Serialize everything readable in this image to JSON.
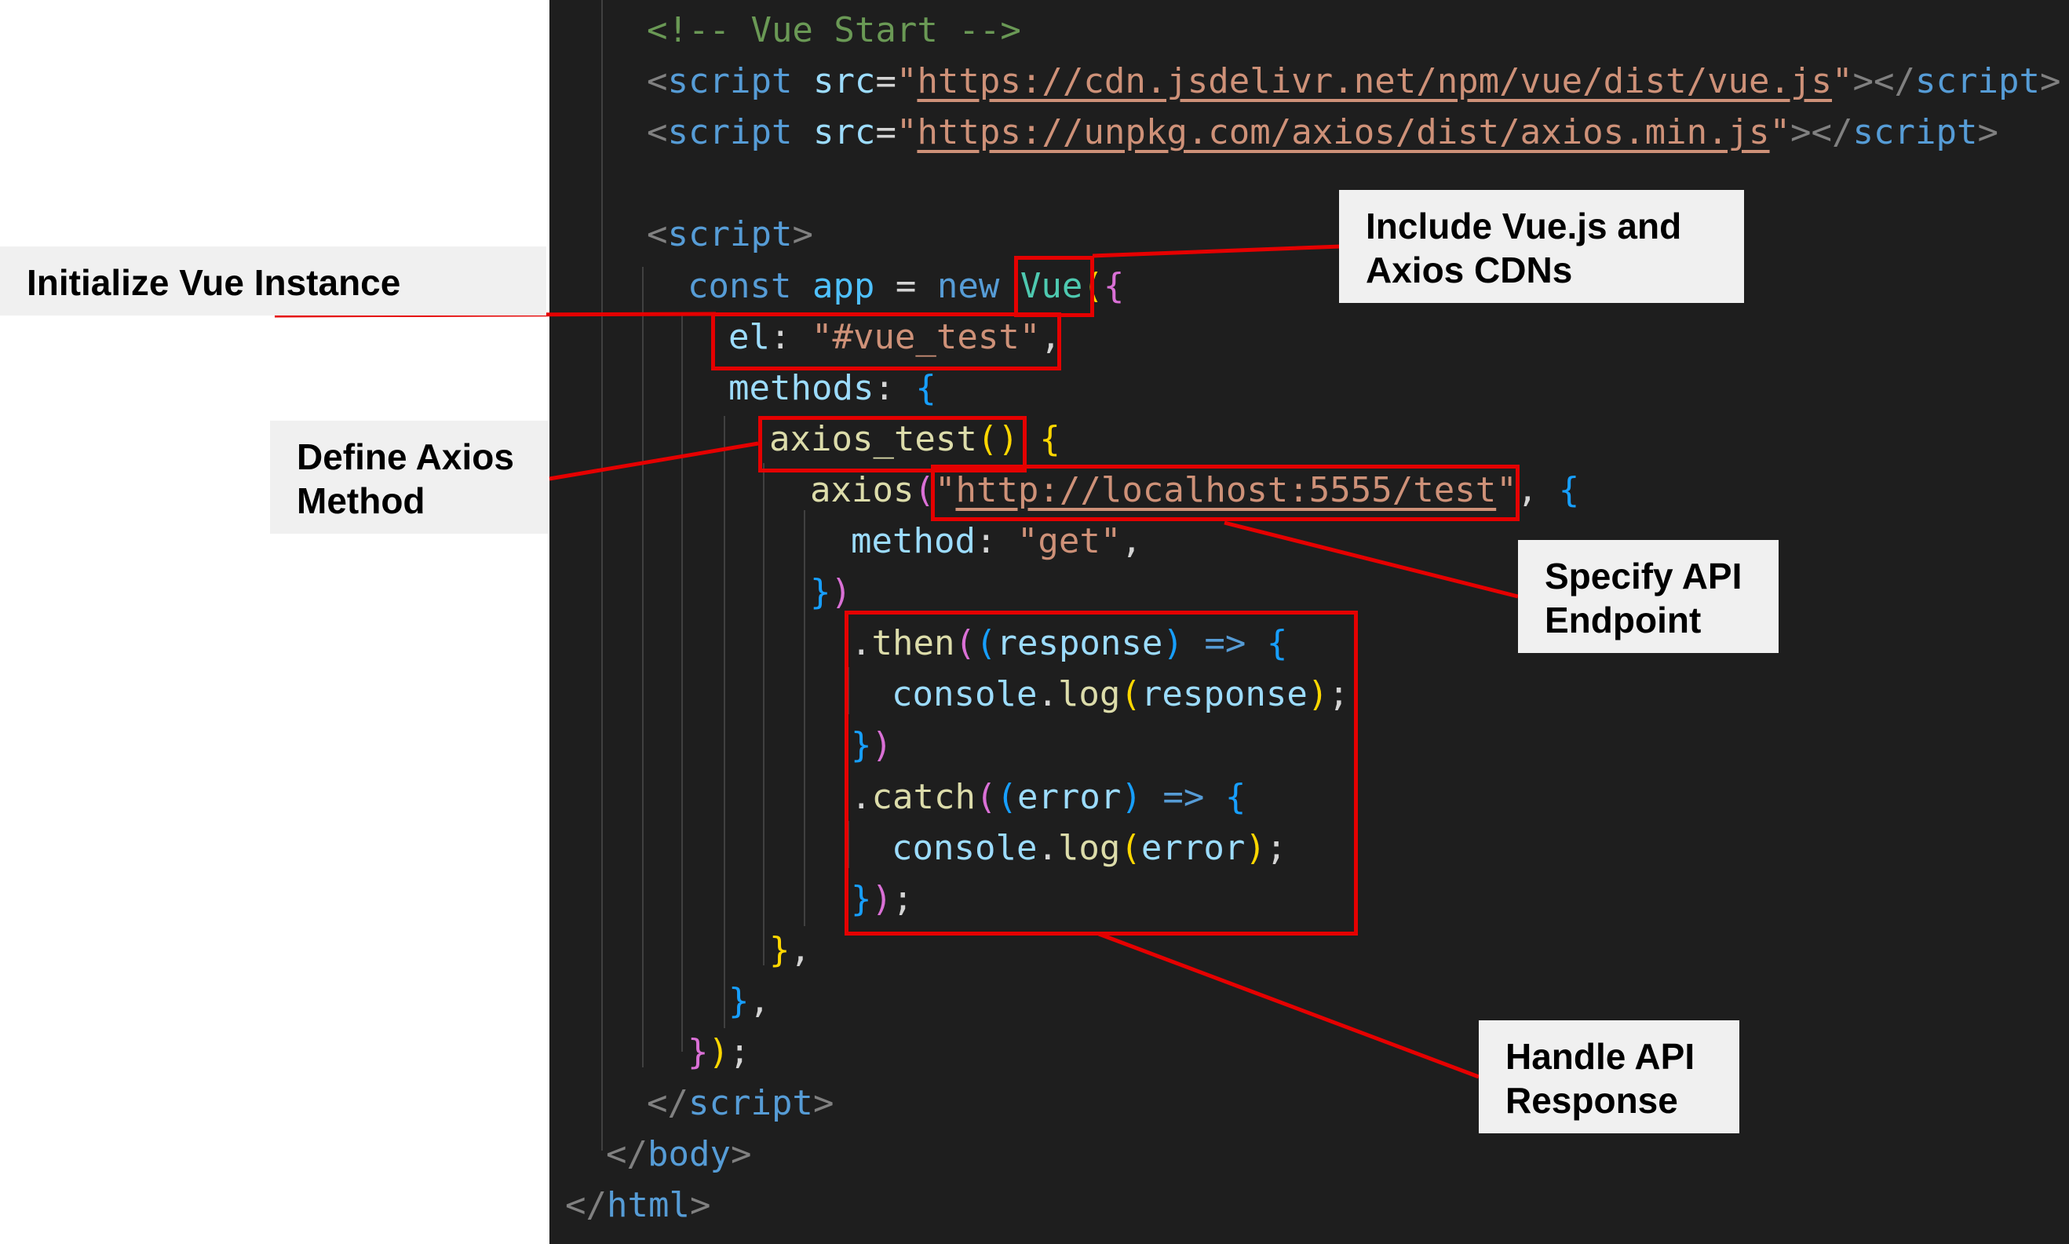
{
  "colors": {
    "editor_bg": "#1e1e1e",
    "comment": "#6a9955",
    "tag": "#569cd6",
    "bracket_angle": "#808080",
    "attribute": "#9cdcfe",
    "string": "#ce9178",
    "keyword": "#569cd6",
    "variable": "#4fc1ff",
    "function": "#dcdcaa",
    "class": "#4ec9b0",
    "bracket_gold": "#ffd700",
    "bracket_pink": "#da70d6",
    "bracket_blue": "#179fff",
    "highlight_red": "#e50000"
  },
  "code": {
    "lines": [
      {
        "tokens": [
          {
            "t": "<!-- Vue Start -->",
            "c": "comment"
          }
        ]
      },
      {
        "tokens": [
          {
            "t": "<",
            "c": "bracket_angle"
          },
          {
            "t": "script",
            "c": "tag"
          },
          {
            "t": " "
          },
          {
            "t": "src",
            "c": "attribute"
          },
          {
            "t": "="
          },
          {
            "t": "\"",
            "c": "string"
          },
          {
            "t": "https://cdn.jsdelivr.net/npm/vue/dist/vue.js",
            "c": "string",
            "u": true
          },
          {
            "t": "\"",
            "c": "string"
          },
          {
            "t": "></",
            "c": "bracket_angle"
          },
          {
            "t": "script",
            "c": "tag"
          },
          {
            "t": ">",
            "c": "bracket_angle"
          }
        ]
      },
      {
        "tokens": [
          {
            "t": "<",
            "c": "bracket_angle"
          },
          {
            "t": "script",
            "c": "tag"
          },
          {
            "t": " "
          },
          {
            "t": "src",
            "c": "attribute"
          },
          {
            "t": "="
          },
          {
            "t": "\"",
            "c": "string"
          },
          {
            "t": "https://unpkg.com/axios/dist/axios.min.js",
            "c": "string",
            "u": true
          },
          {
            "t": "\"",
            "c": "string"
          },
          {
            "t": "></",
            "c": "bracket_angle"
          },
          {
            "t": "script",
            "c": "tag"
          },
          {
            "t": ">",
            "c": "bracket_angle"
          }
        ]
      },
      {
        "tokens": []
      },
      {
        "tokens": [
          {
            "t": "<",
            "c": "bracket_angle"
          },
          {
            "t": "script",
            "c": "tag"
          },
          {
            "t": ">",
            "c": "bracket_angle"
          }
        ]
      },
      {
        "tokens": [
          {
            "t": "const",
            "c": "keyword"
          },
          {
            "t": " "
          },
          {
            "t": "app",
            "c": "variable"
          },
          {
            "t": " = "
          },
          {
            "t": "new",
            "c": "keyword"
          },
          {
            "t": " "
          },
          {
            "t": "Vue",
            "c": "class"
          },
          {
            "t": "(",
            "c": "bracket_gold"
          },
          {
            "t": "{",
            "c": "bracket_pink"
          }
        ]
      },
      {
        "tokens": [
          {
            "t": "el",
            "c": "attribute"
          },
          {
            "t": ": "
          },
          {
            "t": "\"#vue_test\"",
            "c": "string"
          },
          {
            "t": ","
          }
        ]
      },
      {
        "tokens": [
          {
            "t": "methods",
            "c": "attribute"
          },
          {
            "t": ": "
          },
          {
            "t": "{",
            "c": "bracket_blue"
          }
        ]
      },
      {
        "tokens": [
          {
            "t": "axios_test",
            "c": "function"
          },
          {
            "t": "()",
            "c": "bracket_gold"
          },
          {
            "t": " "
          },
          {
            "t": "{",
            "c": "bracket_gold"
          }
        ]
      },
      {
        "tokens": [
          {
            "t": "axios",
            "c": "function"
          },
          {
            "t": "(",
            "c": "bracket_pink"
          },
          {
            "t": "\"",
            "c": "string"
          },
          {
            "t": "http://localhost:5555/test",
            "c": "string",
            "u": true
          },
          {
            "t": "\"",
            "c": "string"
          },
          {
            "t": ", "
          },
          {
            "t": "{",
            "c": "bracket_blue"
          }
        ]
      },
      {
        "tokens": [
          {
            "t": "method",
            "c": "attribute"
          },
          {
            "t": ": "
          },
          {
            "t": "\"get\"",
            "c": "string"
          },
          {
            "t": ","
          }
        ]
      },
      {
        "tokens": [
          {
            "t": "}",
            "c": "bracket_blue"
          },
          {
            "t": ")",
            "c": "bracket_pink"
          }
        ]
      },
      {
        "tokens": [
          {
            "t": "."
          },
          {
            "t": "then",
            "c": "function"
          },
          {
            "t": "(",
            "c": "bracket_pink"
          },
          {
            "t": "(",
            "c": "bracket_blue"
          },
          {
            "t": "response",
            "c": "attribute"
          },
          {
            "t": ")",
            "c": "bracket_blue"
          },
          {
            "t": " "
          },
          {
            "t": "=>",
            "c": "keyword"
          },
          {
            "t": " "
          },
          {
            "t": "{",
            "c": "bracket_blue"
          }
        ]
      },
      {
        "tokens": [
          {
            "t": "console",
            "c": "attribute"
          },
          {
            "t": "."
          },
          {
            "t": "log",
            "c": "function"
          },
          {
            "t": "(",
            "c": "bracket_gold"
          },
          {
            "t": "response",
            "c": "attribute"
          },
          {
            "t": ")",
            "c": "bracket_gold"
          },
          {
            "t": ";"
          }
        ]
      },
      {
        "tokens": [
          {
            "t": "}",
            "c": "bracket_blue"
          },
          {
            "t": ")",
            "c": "bracket_pink"
          }
        ]
      },
      {
        "tokens": [
          {
            "t": "."
          },
          {
            "t": "catch",
            "c": "function"
          },
          {
            "t": "(",
            "c": "bracket_pink"
          },
          {
            "t": "(",
            "c": "bracket_blue"
          },
          {
            "t": "error",
            "c": "attribute"
          },
          {
            "t": ")",
            "c": "bracket_blue"
          },
          {
            "t": " "
          },
          {
            "t": "=>",
            "c": "keyword"
          },
          {
            "t": " "
          },
          {
            "t": "{",
            "c": "bracket_blue"
          }
        ]
      },
      {
        "tokens": [
          {
            "t": "console",
            "c": "attribute"
          },
          {
            "t": "."
          },
          {
            "t": "log",
            "c": "function"
          },
          {
            "t": "(",
            "c": "bracket_gold"
          },
          {
            "t": "error",
            "c": "attribute"
          },
          {
            "t": ")",
            "c": "bracket_gold"
          },
          {
            "t": ";"
          }
        ]
      },
      {
        "tokens": [
          {
            "t": "}",
            "c": "bracket_blue"
          },
          {
            "t": ")",
            "c": "bracket_pink"
          },
          {
            "t": ";"
          }
        ]
      },
      {
        "tokens": [
          {
            "t": "}",
            "c": "bracket_gold"
          },
          {
            "t": ","
          }
        ]
      },
      {
        "tokens": [
          {
            "t": "}",
            "c": "bracket_blue"
          },
          {
            "t": ","
          }
        ]
      },
      {
        "tokens": [
          {
            "t": "}",
            "c": "bracket_pink"
          },
          {
            "t": ")",
            "c": "bracket_gold"
          },
          {
            "t": ";"
          }
        ]
      },
      {
        "tokens": [
          {
            "t": "</",
            "c": "bracket_angle"
          },
          {
            "t": "script",
            "c": "tag"
          },
          {
            "t": ">",
            "c": "bracket_angle"
          }
        ]
      },
      {
        "tokens": [
          {
            "t": "</",
            "c": "bracket_angle"
          },
          {
            "t": "body",
            "c": "tag"
          },
          {
            "t": ">",
            "c": "bracket_angle"
          }
        ]
      },
      {
        "tokens": [
          {
            "t": "</",
            "c": "bracket_angle"
          },
          {
            "t": "html",
            "c": "tag"
          },
          {
            "t": ">",
            "c": "bracket_angle"
          }
        ]
      }
    ]
  },
  "callouts": {
    "include_cdns": {
      "line1": "Include Vue.js and",
      "line2": "Axios CDNs"
    },
    "init_vue": {
      "line1": "Initialize Vue Instance"
    },
    "define_axios": {
      "line1": "Define Axios",
      "line2": "Method"
    },
    "specify_api": {
      "line1": "Specify API",
      "line2": "Endpoint"
    },
    "handle_response": {
      "line1": "Handle API",
      "line2": "Response"
    }
  }
}
